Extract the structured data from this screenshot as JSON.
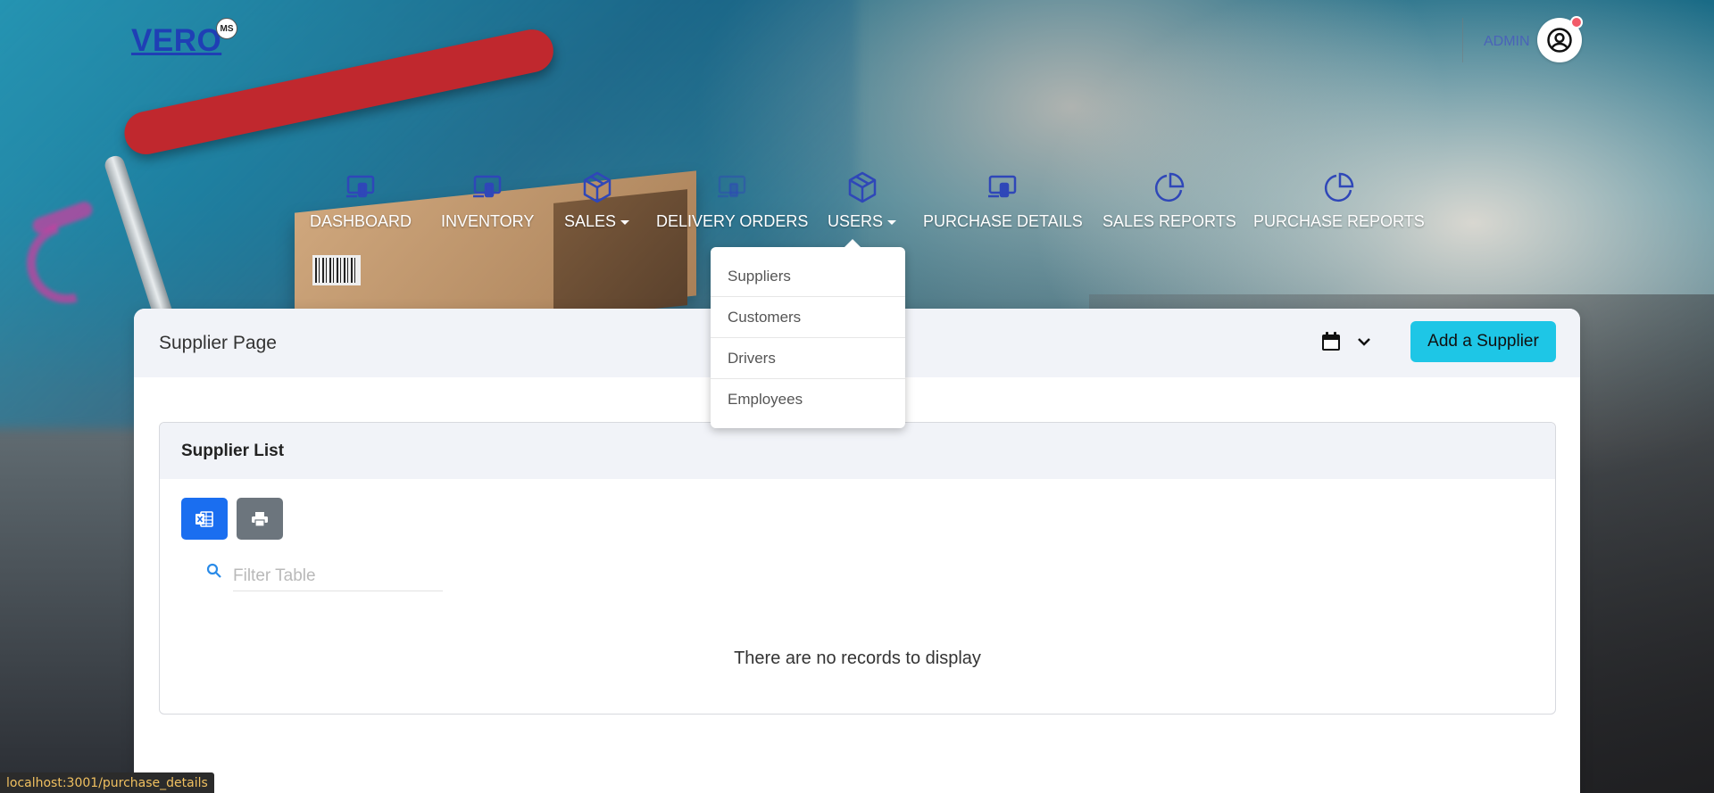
{
  "brand": {
    "logo_text": "VERO",
    "badge_text": "MS"
  },
  "header": {
    "user_label": "ADMIN"
  },
  "nav": {
    "items": [
      {
        "label": "DASHBOARD",
        "icon": "devices-icon",
        "has_caret": false
      },
      {
        "label": "INVENTORY",
        "icon": "devices-icon",
        "has_caret": false
      },
      {
        "label": "SALES",
        "icon": "box-icon",
        "has_caret": true
      },
      {
        "label": "DELIVERY ORDERS",
        "icon": "devices-icon",
        "has_caret": false
      },
      {
        "label": "USERS",
        "icon": "box-icon",
        "has_caret": true
      },
      {
        "label": "PURCHASE DETAILS",
        "icon": "devices-icon",
        "has_caret": false
      },
      {
        "label": "SALES REPORTS",
        "icon": "pie-chart-icon",
        "has_caret": false
      },
      {
        "label": "PURCHASE REPORTS",
        "icon": "pie-chart-icon",
        "has_caret": false
      }
    ]
  },
  "users_dropdown": {
    "items": [
      "Suppliers",
      "Customers",
      "Drivers",
      "Employees"
    ]
  },
  "page": {
    "title": "Supplier Page",
    "add_button_label": "Add a Supplier"
  },
  "supplier_list": {
    "heading": "Supplier List",
    "filter_placeholder": "Filter Table",
    "empty_message": "There are no records to display"
  },
  "status_bar": {
    "url": "localhost:3001/purchase_details"
  },
  "colors": {
    "brand_blue": "#1f3fb5",
    "nav_icon": "#2f47b8",
    "accent_cyan": "#1ec6e6",
    "excel_button": "#1a6ef0",
    "print_button": "#6c757d",
    "notification": "#f25c6a"
  }
}
